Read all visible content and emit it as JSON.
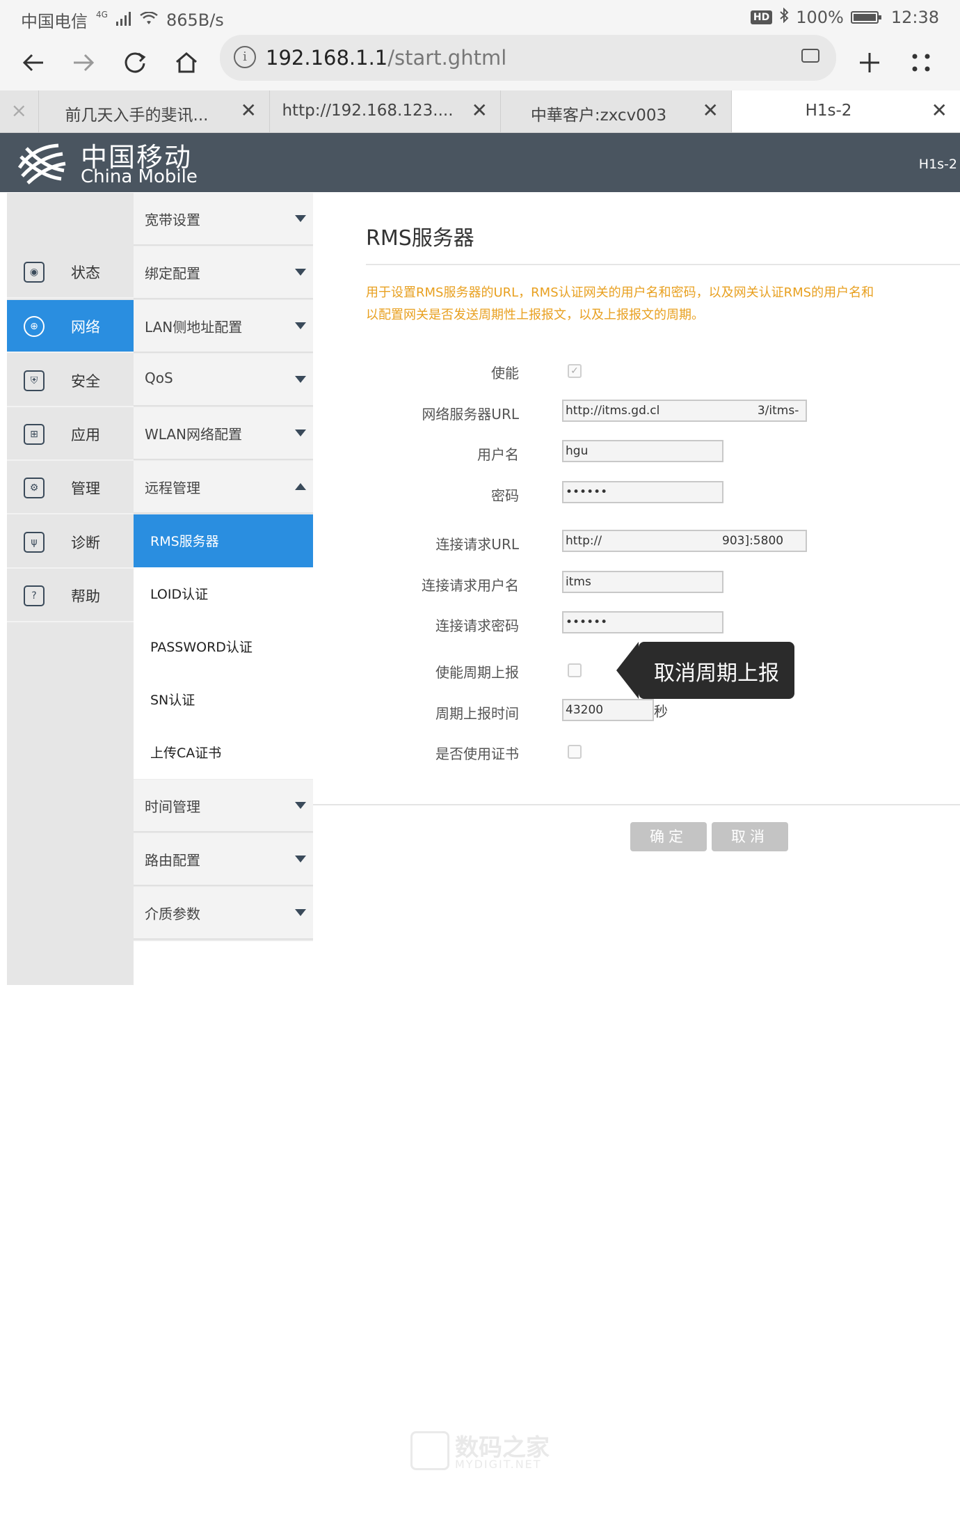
{
  "status_bar": {
    "carrier": "中国电信",
    "network": "4G",
    "speed": "865B/s",
    "hd_badge": "HD",
    "bluetooth": "bluetooth-icon",
    "battery": "100%",
    "time": "12:38"
  },
  "browser": {
    "url_host": "192.168.1.1",
    "url_path": "/start.ghtml",
    "tabs": [
      {
        "label": "×"
      },
      {
        "label": "前几天入手的斐讯..."
      },
      {
        "label": "http://192.168.123...."
      },
      {
        "label": "中華客户:zxcv003"
      },
      {
        "label": "H1s-2"
      }
    ],
    "close_glyph": "✕"
  },
  "header": {
    "brand_cn": "中国移动",
    "brand_en": "China Mobile",
    "device": "H1s-2"
  },
  "nav": {
    "items": [
      {
        "label": "状态",
        "icon": "status-icon"
      },
      {
        "label": "网络",
        "icon": "globe-icon"
      },
      {
        "label": "安全",
        "icon": "shield-icon"
      },
      {
        "label": "应用",
        "icon": "apps-icon"
      },
      {
        "label": "管理",
        "icon": "gear-icon"
      },
      {
        "label": "诊断",
        "icon": "stethoscope-icon"
      },
      {
        "label": "帮助",
        "icon": "help-icon"
      }
    ]
  },
  "submenu": {
    "items": [
      {
        "label": "宽带设置"
      },
      {
        "label": "绑定配置"
      },
      {
        "label": "LAN侧地址配置"
      },
      {
        "label": "QoS"
      },
      {
        "label": "WLAN网络配置"
      },
      {
        "label": "远程管理"
      }
    ],
    "children": [
      {
        "label": "RMS服务器"
      },
      {
        "label": "LOID认证"
      },
      {
        "label": "PASSWORD认证"
      },
      {
        "label": "SN认证"
      },
      {
        "label": "上传CA证书"
      }
    ],
    "after": [
      {
        "label": "时间管理"
      },
      {
        "label": "路由配置"
      },
      {
        "label": "介质参数"
      }
    ]
  },
  "main": {
    "title": "RMS服务器",
    "desc_line1": "用于设置RMS服务器的URL，RMS认证网关的用户名和密码，以及网关认证RMS的用户名和",
    "desc_line2": "以配置网关是否发送周期性上报报文，以及上报报文的周期。",
    "fields": {
      "enable_label": "使能",
      "enable_checked": true,
      "acs_url_label": "网络服务器URL",
      "acs_url_value": "http://itms.gd.cl                          3/itms-",
      "username_label": "用户名",
      "username_value": "hgu",
      "password_label": "密码",
      "password_value": "••••••",
      "conn_url_label": "连接请求URL",
      "conn_url_value": "http://                                903]:5800",
      "conn_user_label": "连接请求用户名",
      "conn_user_value": "itms",
      "conn_pass_label": "连接请求密码",
      "conn_pass_value": "••••••",
      "periodic_label": "使能周期上报",
      "periodic_checked": false,
      "interval_label": "周期上报时间",
      "interval_value": "43200",
      "interval_unit": "秒",
      "cert_label": "是否使用证书",
      "cert_checked": false
    },
    "tooltip": "取消周期上报",
    "ok_button": "确定",
    "cancel_button": "取消"
  },
  "watermark": {
    "cn": "数码之家",
    "en": "MYDIGIT.NET"
  },
  "colors": {
    "accent": "#2a8ee0",
    "header_bg": "#4a5560",
    "hint_text": "#e8a020"
  }
}
